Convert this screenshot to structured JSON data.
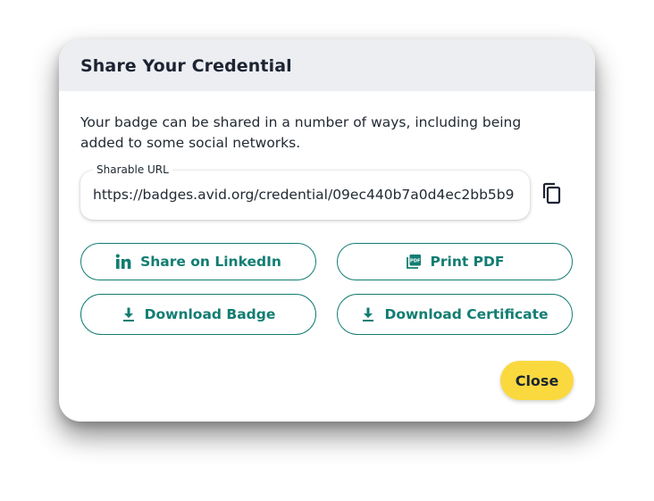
{
  "dialog": {
    "title": "Share Your Credential",
    "description": "Your badge can be shared in a number of ways, including being added to some social networks."
  },
  "url_field": {
    "label": "Sharable URL",
    "value": "https://badges.avid.org/credential/09ec440b7a0d4ec2bb5b9"
  },
  "actions": {
    "linkedin": {
      "label": "Share on LinkedIn",
      "icon": "linkedin-icon"
    },
    "pdf": {
      "label": "Print PDF",
      "icon": "pdf-icon"
    },
    "badge": {
      "label": "Download Badge",
      "icon": "download-icon"
    },
    "certificate": {
      "label": "Download Certificate",
      "icon": "download-icon"
    }
  },
  "copy": {
    "icon": "copy-icon"
  },
  "close": {
    "label": "Close"
  },
  "colors": {
    "accent": "#127d72",
    "close_bg": "#fad93e",
    "header_bg": "#eceef1",
    "text": "#1c2433"
  }
}
